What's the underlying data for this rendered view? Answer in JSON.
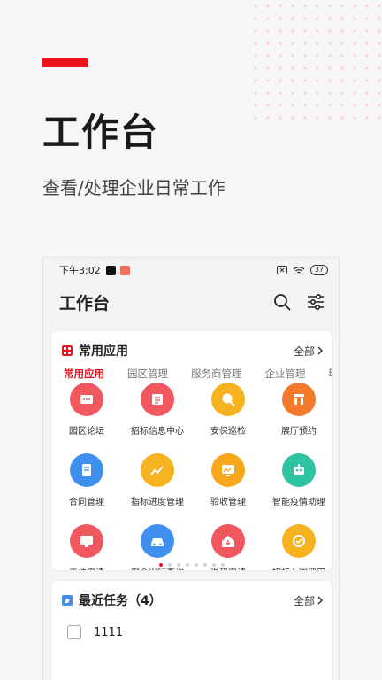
{
  "hero": {
    "title": "工作台",
    "subtitle": "查看/处理企业日常工作"
  },
  "status_bar": {
    "time": "下午3:02",
    "battery": "37"
  },
  "header": {
    "title": "工作台"
  },
  "common_apps": {
    "title": "常用应用",
    "all_label": "全部",
    "tabs": [
      {
        "label": "常用应用",
        "active": true
      },
      {
        "label": "园区管理"
      },
      {
        "label": "服务商管理"
      },
      {
        "label": "企业管理"
      },
      {
        "label": "E"
      }
    ],
    "apps": [
      {
        "label": "园区论坛",
        "icon": "chat-icon",
        "color": "#f0575f"
      },
      {
        "label": "招标信息中心",
        "icon": "bid-icon",
        "color": "#f0575f"
      },
      {
        "label": "安保巡检",
        "icon": "security-patrol-icon",
        "color": "#f7b31f"
      },
      {
        "label": "展厅预约",
        "icon": "hall-icon",
        "color": "#f27a2a"
      },
      {
        "label": "合同管理",
        "icon": "contract-icon",
        "color": "#3f8fef"
      },
      {
        "label": "指标进度管理",
        "icon": "chart-icon",
        "color": "#f7b31f"
      },
      {
        "label": "验收管理",
        "icon": "monitor-icon",
        "color": "#f7a71b"
      },
      {
        "label": "智能疫情助理",
        "icon": "robot-icon",
        "color": "#2ec4a1"
      },
      {
        "label": "工位申请",
        "icon": "desktop-icon",
        "color": "#f0575f"
      },
      {
        "label": "安全出行查询",
        "icon": "car-icon",
        "color": "#3f8fef"
      },
      {
        "label": "退租申请",
        "icon": "house-icon",
        "color": "#f0575f"
      },
      {
        "label": "招标入围评审",
        "icon": "badge-icon",
        "color": "#f7b31f"
      }
    ],
    "page_count": 8,
    "active_page": 1
  },
  "recent_tasks": {
    "title": "最近任务（4）",
    "all_label": "全部",
    "items": [
      {
        "label": "1111"
      }
    ]
  },
  "colors": {
    "accent": "#e8141c",
    "blue": "#3f8fef"
  }
}
